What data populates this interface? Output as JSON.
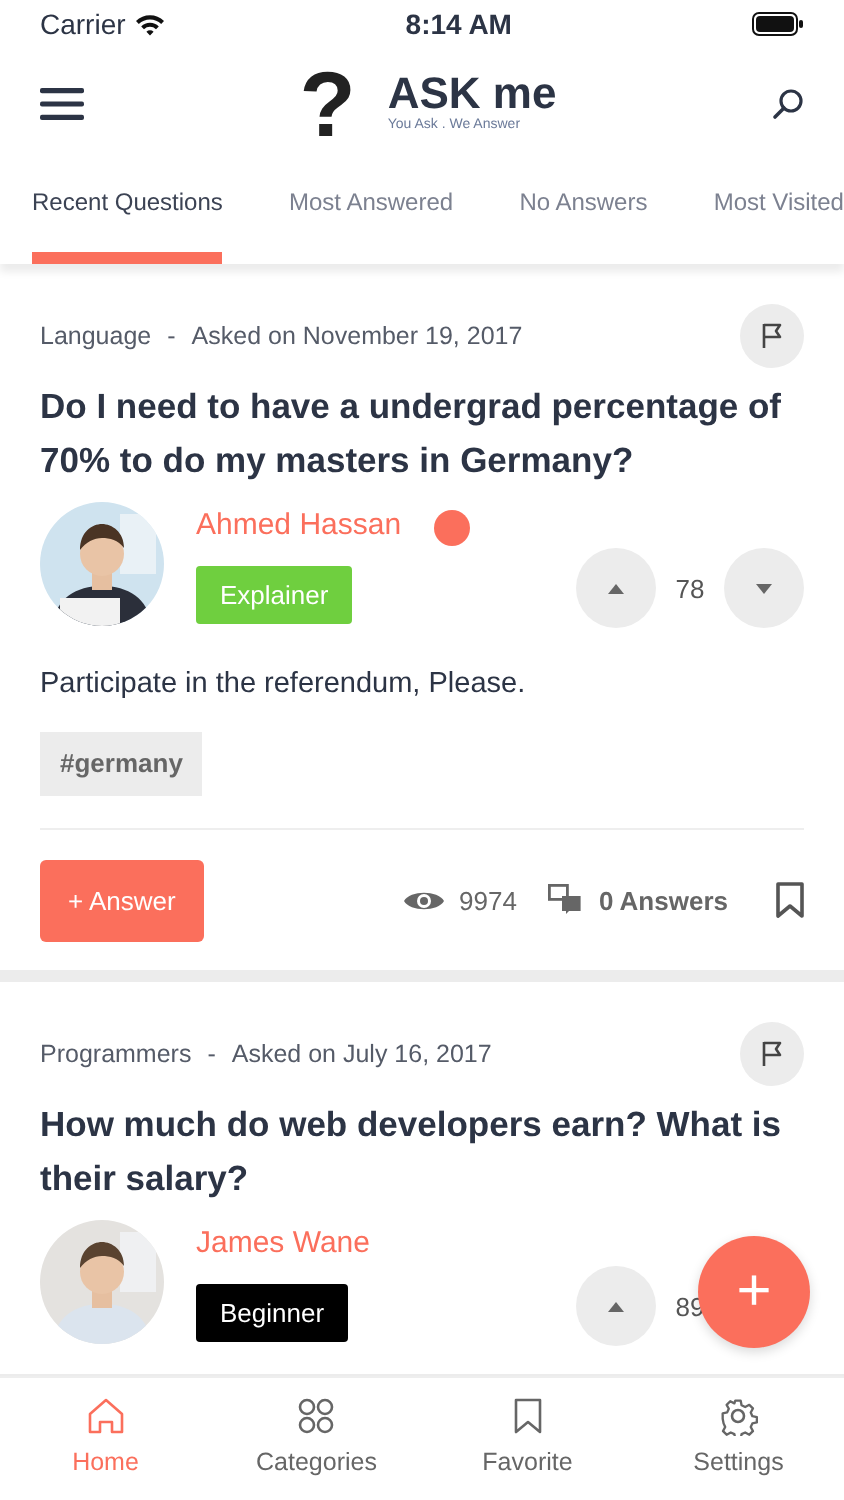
{
  "status_bar": {
    "carrier": "Carrier",
    "time": "8:14 AM"
  },
  "header": {
    "logo_mark": "?",
    "logo_title": "ASK me",
    "logo_tagline": "You Ask . We Answer"
  },
  "tabs": [
    {
      "label": "Recent Questions",
      "selected": true
    },
    {
      "label": "Most Answered",
      "selected": false
    },
    {
      "label": "No Answers",
      "selected": false
    },
    {
      "label": "Most Visited",
      "selected": false
    }
  ],
  "questions": [
    {
      "category": "Language",
      "separator": "-",
      "asked": "Asked on November 19, 2017",
      "title": "Do I need to have a undergrad percentage of 70% to do my masters in Germany?",
      "author": "Ahmed Hassan",
      "author_dot": {
        "color": "#fb6f5c"
      },
      "badge": {
        "label": "Explainer",
        "color": "#6fcf3f"
      },
      "votes": "78",
      "downvote": true,
      "body": "Participate in the referendum, Please.",
      "tag": "#germany",
      "answer_button": "+ Answer",
      "views": "9974",
      "answers": "0 Answers"
    },
    {
      "category": "Programmers",
      "separator": "-",
      "asked": "Asked on July 16, 2017",
      "title": "How much do web developers earn? What is their salary?",
      "author": "James Wane",
      "badge": {
        "label": "Beginner",
        "color": "#000000"
      },
      "votes": "89",
      "downvote": false
    }
  ],
  "fab": {
    "label": "+"
  },
  "bottom_nav": [
    {
      "label": "Home",
      "kind": "home",
      "selected": true
    },
    {
      "label": "Categories",
      "kind": "grid",
      "selected": false
    },
    {
      "label": "Favorite",
      "kind": "bookmark",
      "selected": false
    },
    {
      "label": "Settings",
      "kind": "gear",
      "selected": false
    }
  ]
}
